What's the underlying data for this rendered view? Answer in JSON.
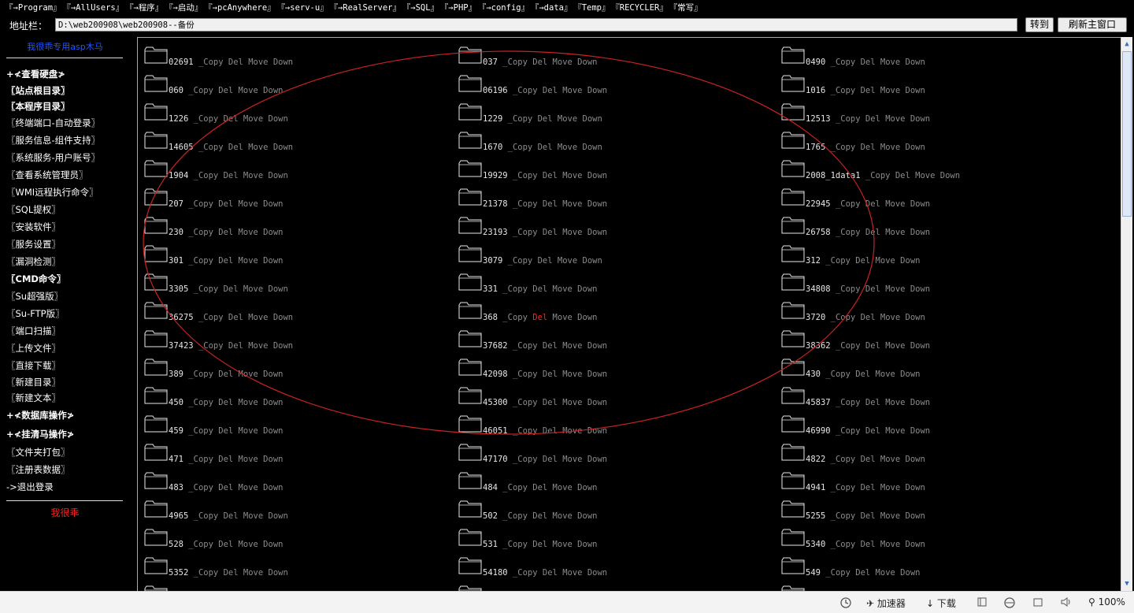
{
  "nav": [
    "『→Program』",
    "『→AllUsers』",
    "『→程序』",
    "『→启动』",
    "『→pcAnywhere』",
    "『→serv-u』",
    "『→RealServer』",
    "『→SQL』",
    "『→PHP』",
    "『→config』",
    "『→data』",
    "『Temp』",
    "『RECYCLER』",
    "『常写』"
  ],
  "address": {
    "label": "地址栏：",
    "value": "D:\\web200908\\web200908--备份",
    "go": "转到",
    "refresh": "刷新主窗口"
  },
  "sidebar": {
    "brand": "我很乖专用asp木马",
    "items": [
      {
        "label": "+≮查看硬盘≯",
        "bold": true
      },
      {
        "label": "〖站点根目录〗",
        "bold": true
      },
      {
        "label": "〖本程序目录〗",
        "bold": true
      },
      {
        "label": "〖终端端口-自动登录〗",
        "bold": false
      },
      {
        "label": "〖服务信息-组件支持〗",
        "bold": false
      },
      {
        "label": "〖系统服务-用户账号〗",
        "bold": false
      },
      {
        "label": "〖查看系统管理员〗",
        "bold": false
      },
      {
        "label": "〖WMI远程执行命令〗",
        "bold": false
      },
      {
        "label": "〖SQL提权〗",
        "bold": false
      },
      {
        "label": "〖安装软件〗",
        "bold": false
      },
      {
        "label": "〖服务设置〗",
        "bold": false
      },
      {
        "label": "〖漏洞检测〗",
        "bold": false
      },
      {
        "label": "〖CMD命令〗",
        "bold": true
      },
      {
        "label": "〖Su超强版〗",
        "bold": false
      },
      {
        "label": "〖Su-FTP版〗",
        "bold": false
      },
      {
        "label": "〖端口扫描〗",
        "bold": false
      },
      {
        "label": "〖上传文件〗",
        "bold": false
      },
      {
        "label": "〖直接下载〗",
        "bold": false
      },
      {
        "label": "〖新建目录〗",
        "bold": false
      },
      {
        "label": "〖新建文本〗",
        "bold": false
      },
      {
        "label": "+≮数据库操作≯",
        "bold": true
      },
      {
        "label": "+≮挂清马操作≯",
        "bold": true
      },
      {
        "label": "〖文件夹打包〗",
        "bold": false
      },
      {
        "label": "〖注册表数据〗",
        "bold": false
      },
      {
        "label": "->退出登录",
        "bold": false
      }
    ],
    "footer": "我很乖"
  },
  "actions": [
    "Copy",
    "Del",
    "Move",
    "Down"
  ],
  "folders": [
    [
      "02691",
      "037",
      "0490"
    ],
    [
      "060",
      "06196",
      "1016"
    ],
    [
      "1226",
      "1229",
      "12513"
    ],
    [
      "14605",
      "1670",
      "1765"
    ],
    [
      "1904",
      "19929",
      "2008_1data1"
    ],
    [
      "207",
      "21378",
      "22945"
    ],
    [
      "230",
      "23193",
      "26758"
    ],
    [
      "301",
      "3079",
      "312"
    ],
    [
      "3305",
      "331",
      "34808"
    ],
    [
      "36275",
      "368",
      "3720"
    ],
    [
      "37423",
      "37682",
      "38362"
    ],
    [
      "389",
      "42098",
      "430"
    ],
    [
      "450",
      "45300",
      "45837"
    ],
    [
      "459",
      "46051",
      "46990"
    ],
    [
      "471",
      "47170",
      "4822"
    ],
    [
      "483",
      "484",
      "4941"
    ],
    [
      "4965",
      "502",
      "5255"
    ],
    [
      "528",
      "531",
      "5340"
    ],
    [
      "5352",
      "54180",
      "549"
    ],
    [
      "",
      "",
      ""
    ]
  ],
  "highlighted_del": "368",
  "status": {
    "accelerator": "加速器",
    "download": "下载",
    "zoom": "100%"
  },
  "colors": {
    "annotation": "#cc2222",
    "folder_outline": "#e8e8e8",
    "action_text": "#8c8c8c",
    "highlight": "#ff2222"
  }
}
